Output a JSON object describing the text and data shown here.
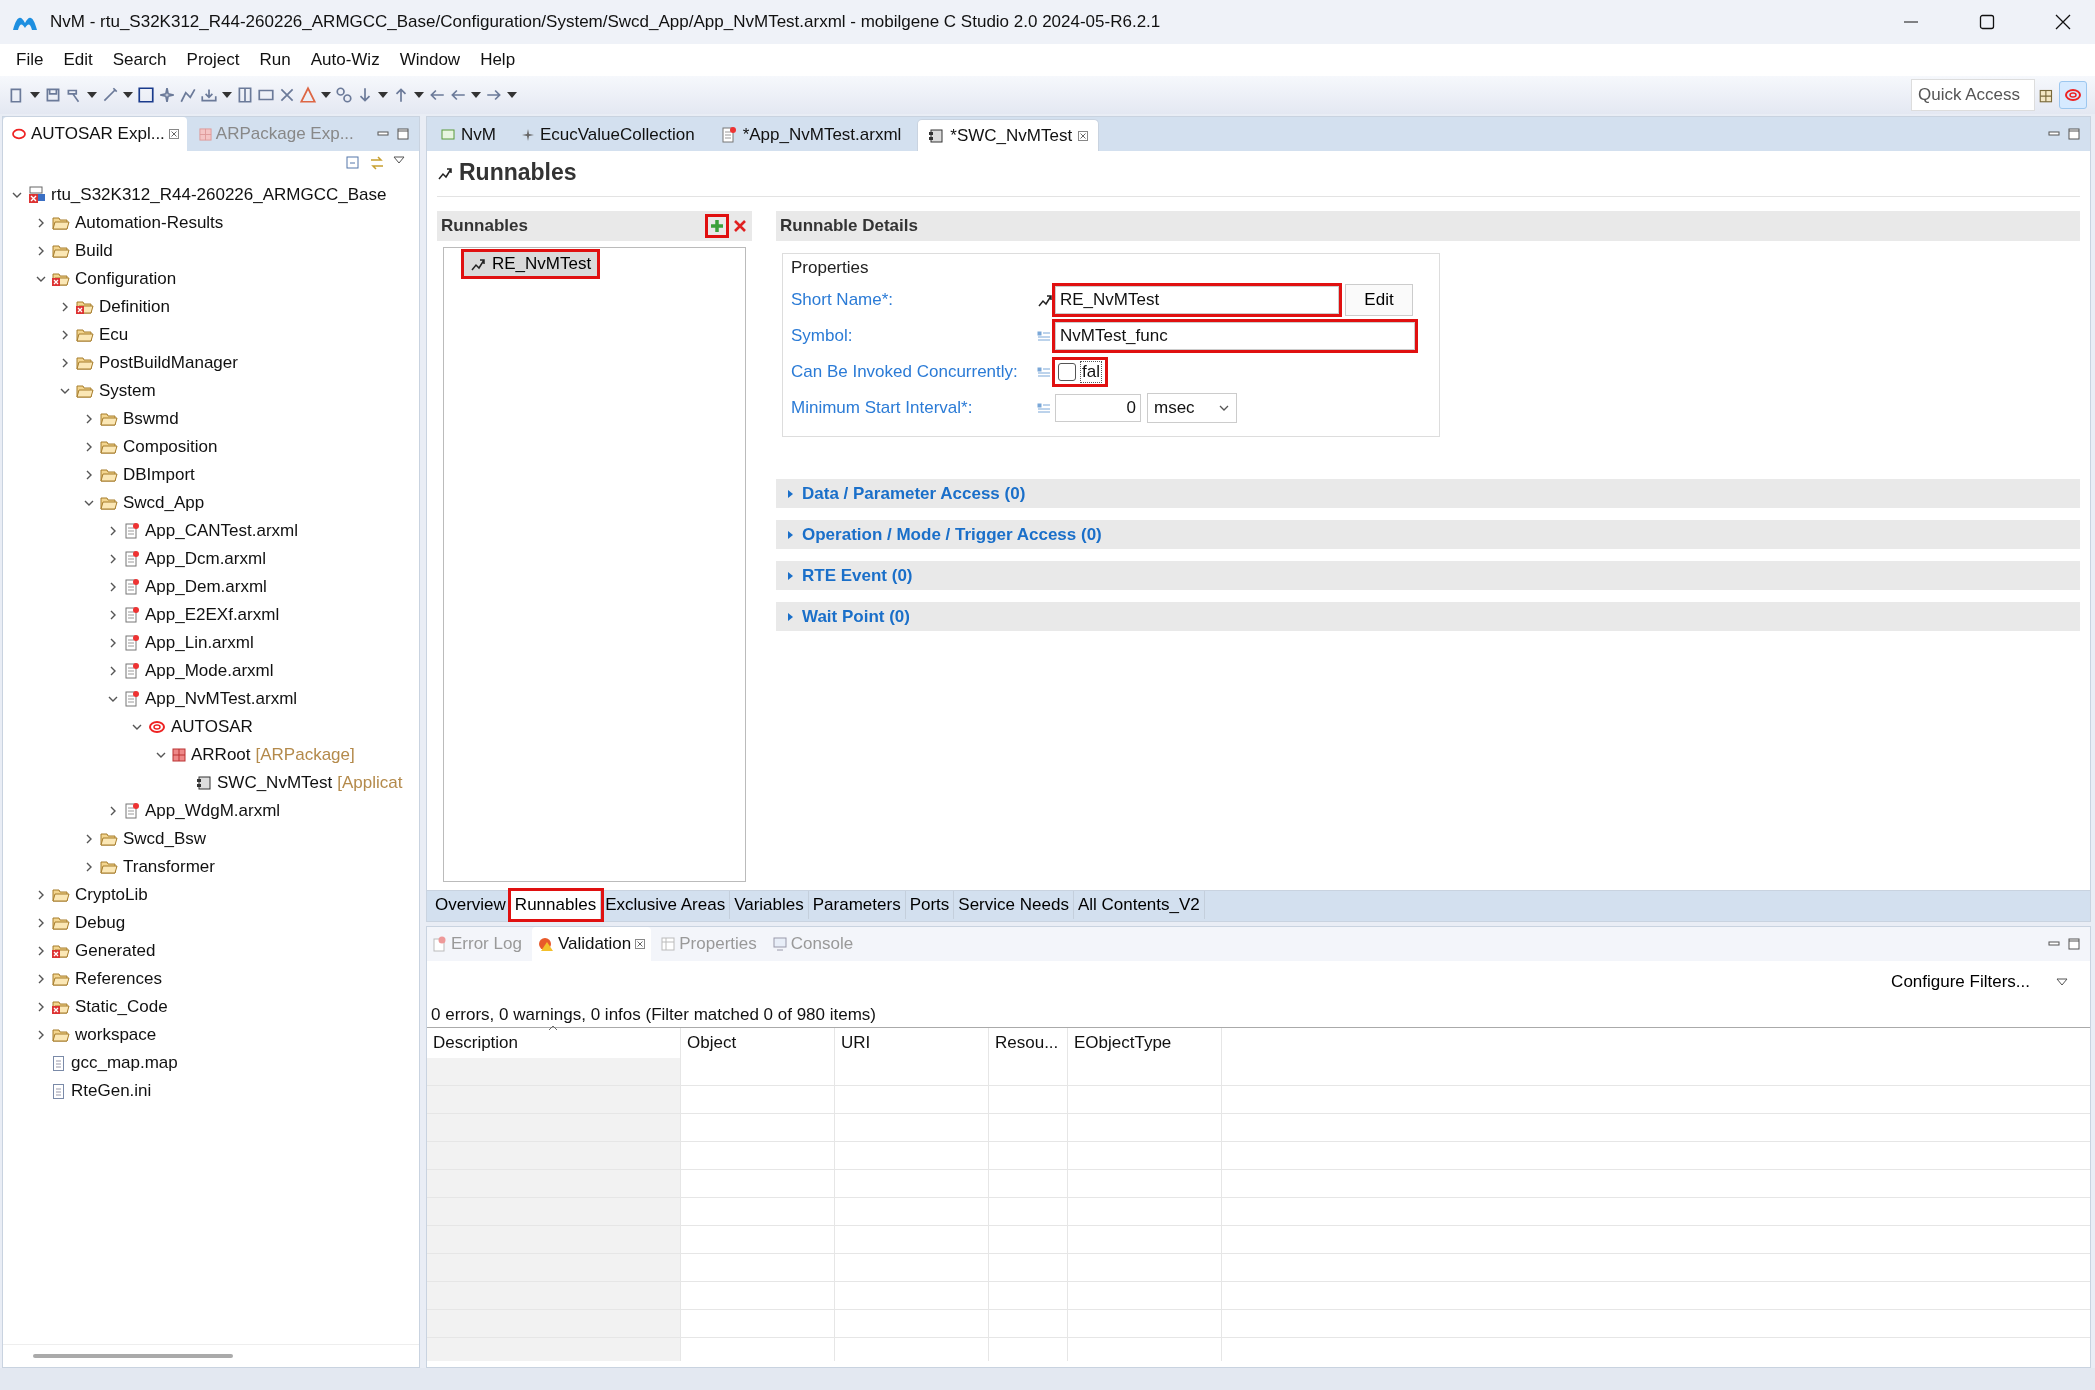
{
  "window": {
    "title": "NvM - rtu_S32K312_R44-260226_ARMGCC_Base/Configuration/System/Swcd_App/App_NvMTest.arxml - mobilgene C Studio 2.0 2024-05-R6.2.1"
  },
  "menu": [
    "File",
    "Edit",
    "Search",
    "Project",
    "Run",
    "Auto-Wiz",
    "Window",
    "Help"
  ],
  "quick_access": {
    "placeholder": "Quick Access"
  },
  "explorer": {
    "tabs": [
      {
        "label": "AUTOSAR Expl...",
        "selected": true
      },
      {
        "label": "ARPackage Exp...",
        "selected": false
      }
    ],
    "tree": [
      {
        "kind": "project",
        "label": "rtu_S32K312_R44-260226_ARMGCC_Base",
        "expanded": true,
        "children": [
          {
            "kind": "folder",
            "label": "Automation-Results",
            "expanded": false
          },
          {
            "kind": "folder",
            "label": "Build",
            "expanded": false
          },
          {
            "kind": "folder-error",
            "label": "Configuration",
            "expanded": true,
            "children": [
              {
                "kind": "folder-error",
                "label": "Definition",
                "expanded": false
              },
              {
                "kind": "folder",
                "label": "Ecu",
                "expanded": false
              },
              {
                "kind": "folder",
                "label": "PostBuildManager",
                "expanded": false
              },
              {
                "kind": "folder",
                "label": "System",
                "expanded": true,
                "children": [
                  {
                    "kind": "folder",
                    "label": "Bswmd",
                    "expanded": false
                  },
                  {
                    "kind": "folder",
                    "label": "Composition",
                    "expanded": false
                  },
                  {
                    "kind": "folder",
                    "label": "DBImport",
                    "expanded": false
                  },
                  {
                    "kind": "folder",
                    "label": "Swcd_App",
                    "expanded": true,
                    "children": [
                      {
                        "kind": "file",
                        "label": "App_CANTest.arxml",
                        "expanded": false
                      },
                      {
                        "kind": "file",
                        "label": "App_Dcm.arxml",
                        "expanded": false
                      },
                      {
                        "kind": "file",
                        "label": "App_Dem.arxml",
                        "expanded": false
                      },
                      {
                        "kind": "file",
                        "label": "App_E2EXf.arxml",
                        "expanded": false
                      },
                      {
                        "kind": "file",
                        "label": "App_Lin.arxml",
                        "expanded": false
                      },
                      {
                        "kind": "file",
                        "label": "App_Mode.arxml",
                        "expanded": false
                      },
                      {
                        "kind": "file",
                        "label": "App_NvMTest.arxml",
                        "expanded": true,
                        "children": [
                          {
                            "kind": "autosar",
                            "label": "AUTOSAR",
                            "expanded": true,
                            "children": [
                              {
                                "kind": "package",
                                "label": "ARRoot",
                                "suffix": "[ARPackage]",
                                "expanded": true,
                                "children": [
                                  {
                                    "kind": "swc",
                                    "label": "SWC_NvMTest",
                                    "suffix": "[Applicat"
                                  }
                                ]
                              }
                            ]
                          }
                        ]
                      },
                      {
                        "kind": "file",
                        "label": "App_WdgM.arxml",
                        "expanded": false
                      }
                    ]
                  },
                  {
                    "kind": "folder",
                    "label": "Swcd_Bsw",
                    "expanded": false
                  },
                  {
                    "kind": "folder",
                    "label": "Transformer",
                    "expanded": false
                  }
                ]
              }
            ]
          },
          {
            "kind": "folder",
            "label": "CryptoLib",
            "expanded": false
          },
          {
            "kind": "folder",
            "label": "Debug",
            "expanded": false
          },
          {
            "kind": "folder-error",
            "label": "Generated",
            "expanded": false
          },
          {
            "kind": "folder",
            "label": "References",
            "expanded": false
          },
          {
            "kind": "folder-error",
            "label": "Static_Code",
            "expanded": false
          },
          {
            "kind": "folder",
            "label": "workspace",
            "expanded": false
          },
          {
            "kind": "text-file",
            "label": "gcc_map.map"
          },
          {
            "kind": "text-file",
            "label": "RteGen.ini"
          }
        ]
      }
    ]
  },
  "editor": {
    "tabs": [
      {
        "kind": "module",
        "label": "NvM",
        "selected": false
      },
      {
        "kind": "collection",
        "label": "EcucValueCollection",
        "selected": false
      },
      {
        "kind": "file",
        "label": "*App_NvMTest.arxml",
        "selected": false
      },
      {
        "kind": "swc",
        "label": "*SWC_NvMTest",
        "selected": true
      }
    ],
    "page_title": "Runnables",
    "runnables": {
      "title": "Runnables",
      "add_highlighted": true,
      "items": [
        {
          "label": "RE_NvMTest",
          "selected": true,
          "highlighted": true
        }
      ]
    },
    "details": {
      "title": "Runnable Details",
      "group": "Properties",
      "fields": [
        {
          "kind": "text",
          "label": "Short Name*:",
          "value": "RE_NvMTest",
          "button": "Edit",
          "highlighted": true
        },
        {
          "kind": "text",
          "label": "Symbol:",
          "value": "NvMTest_func",
          "highlighted": true
        },
        {
          "kind": "checkbox",
          "label": "Can Be Invoked Concurrently:",
          "checked": false,
          "value": "fal",
          "highlighted": true
        },
        {
          "kind": "number",
          "label": "Minimum Start Interval*:",
          "value": "0",
          "unit": "msec",
          "highlighted": false
        }
      ]
    },
    "sections": [
      {
        "label": "Data / Parameter Access (0)",
        "expanded": false
      },
      {
        "label": "Operation / Mode / Trigger Access (0)",
        "expanded": false
      },
      {
        "label": "RTE Event (0)",
        "expanded": false
      },
      {
        "label": "Wait Point (0)",
        "expanded": false
      }
    ],
    "page_tabs": [
      {
        "label": "Overview",
        "selected": false,
        "highlighted": false
      },
      {
        "label": "Runnables",
        "selected": true,
        "highlighted": true
      },
      {
        "label": "Exclusive Areas",
        "selected": false,
        "highlighted": false
      },
      {
        "label": "Variables",
        "selected": false,
        "highlighted": false
      },
      {
        "label": "Parameters",
        "selected": false,
        "highlighted": false
      },
      {
        "label": "Ports",
        "selected": false,
        "highlighted": false
      },
      {
        "label": "Service Needs",
        "selected": false,
        "highlighted": false
      },
      {
        "label": "All Contents_V2",
        "selected": false,
        "highlighted": false
      }
    ]
  },
  "bottom": {
    "tabs": [
      {
        "kind": "error-log",
        "label": "Error Log",
        "selected": false
      },
      {
        "kind": "validation",
        "label": "Validation",
        "selected": true
      },
      {
        "kind": "properties",
        "label": "Properties",
        "selected": false
      },
      {
        "kind": "console",
        "label": "Console",
        "selected": false
      }
    ],
    "configure": "Configure Filters...",
    "summary": "0 errors, 0 warnings, 0 infos (Filter matched 0 of 980 items)",
    "columns": [
      "Description",
      "Object",
      "URI",
      "Resou...",
      "EObjectType"
    ]
  }
}
